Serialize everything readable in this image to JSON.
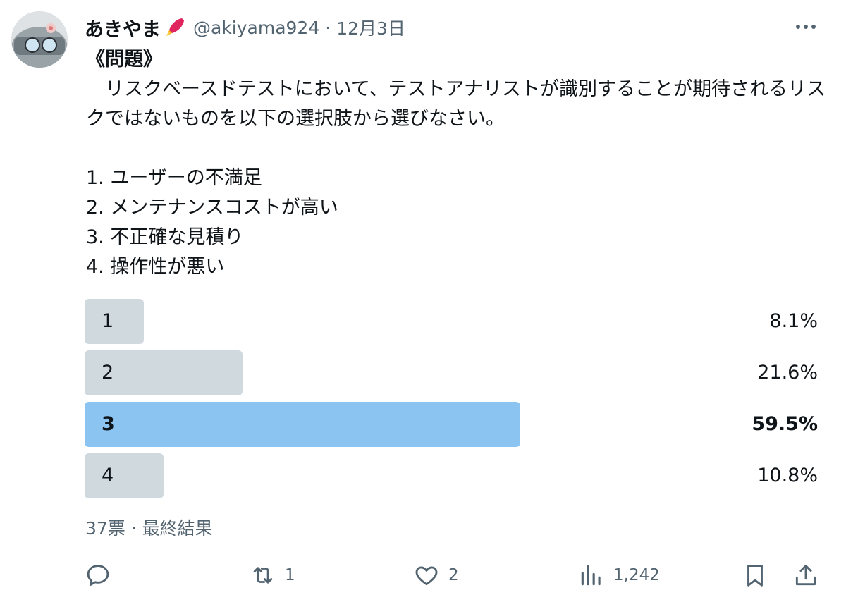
{
  "user": {
    "display_name": "あきやま",
    "handle": "@akiyama924",
    "separator": "·",
    "date": "12月3日",
    "name_emoji": "rocket-emoji",
    "avatar": "avatar-character"
  },
  "tweet": {
    "title": "《問題》",
    "body": "　リスクベースドテストにおいて、テストアナリストが識別することが期待されるリスクではないものを以下の選択肢から選びなさい。\n\n1. ユーザーの不満足\n2. メンテナンスコストが高い\n3. 不正確な見積り\n4. 操作性が悪い"
  },
  "poll": {
    "options": [
      {
        "label": "1",
        "percent_text": "8.1%",
        "percent": 8.1,
        "winner": false
      },
      {
        "label": "2",
        "percent_text": "21.6%",
        "percent": 21.6,
        "winner": false
      },
      {
        "label": "3",
        "percent_text": "59.5%",
        "percent": 59.5,
        "winner": true
      },
      {
        "label": "4",
        "percent_text": "10.8%",
        "percent": 10.8,
        "winner": false
      }
    ],
    "meta": "37票 · 最終結果"
  },
  "actions": {
    "reply": {
      "icon": "reply-icon",
      "count": ""
    },
    "retweet": {
      "icon": "retweet-icon",
      "count": "1"
    },
    "like": {
      "icon": "heart-icon",
      "count": "2"
    },
    "views": {
      "icon": "views-icon",
      "count": "1,242"
    },
    "bookmark": {
      "icon": "bookmark-icon"
    },
    "share": {
      "icon": "share-icon"
    }
  },
  "colors": {
    "bar_default": "#cfd9de",
    "bar_winner": "#8bc4f1",
    "text_primary": "#0f1419",
    "text_secondary": "#536471"
  }
}
